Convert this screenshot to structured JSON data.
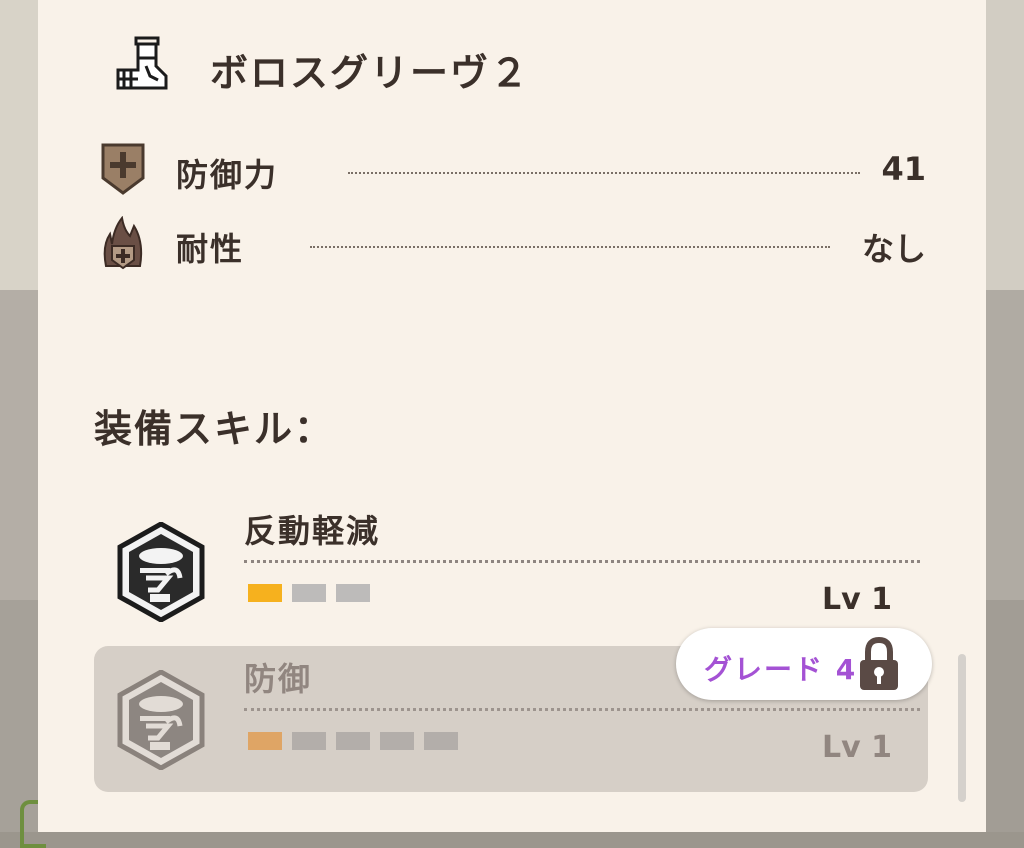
{
  "item": {
    "title": "ボロスグリーヴ２",
    "icon": "armor-legs-icon"
  },
  "stats": [
    {
      "label": "防御力",
      "value": "41",
      "icon": "defense-shield-icon"
    },
    {
      "label": "耐性",
      "value": "なし",
      "icon": "resistance-flame-icon"
    }
  ],
  "skills_heading": "装備スキル：",
  "skills": [
    {
      "name": "反動軽減",
      "level": "Lv 1",
      "pips_filled": 1,
      "pips_total": 3,
      "locked": false,
      "icon": "recoil-reduction-skill-icon"
    },
    {
      "name": "防御",
      "level": "Lv 1",
      "pips_filled": 1,
      "pips_total": 5,
      "locked": true,
      "icon": "defense-skill-icon"
    }
  ],
  "grade_badge": {
    "label": "グレード 4",
    "icon": "lock-icon"
  },
  "colors": {
    "panel_bg": "#f9f2e9",
    "text": "#3b302a",
    "pip_active": "#f6b11e",
    "pip_inactive": "#bdbbba",
    "grade_text": "#a452d4",
    "locked_bg": "#d6cfc7"
  }
}
